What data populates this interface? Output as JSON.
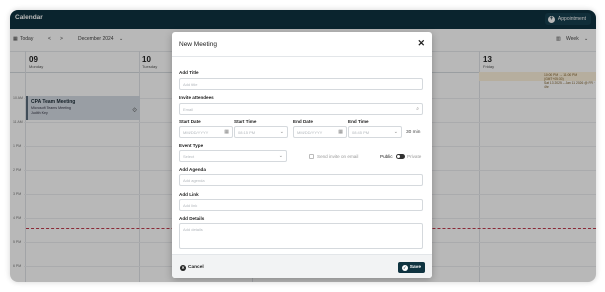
{
  "app": {
    "title": "Calendar",
    "appointment_label": "Appointment"
  },
  "toolbar": {
    "today_label": "Today",
    "prev": "<",
    "next": ">",
    "range": "December 2024",
    "range_arrow": "⌄",
    "view": "Week"
  },
  "days": [
    {
      "num": "09",
      "name": "Monday"
    },
    {
      "num": "10",
      "name": "Tuesday"
    },
    {
      "num": "13",
      "name": "Friday"
    }
  ],
  "times": [
    "10 AM",
    "11 AM",
    "1 PM",
    "2 PM",
    "3 PM",
    "4 PM",
    "5 PM",
    "6 PM",
    "7 PM"
  ],
  "allday_event": {
    "line1": "10:00 PM → 11:00 PM (GMT+05:30)",
    "line2": "Sat 13 2025 – Jan 11 2026 @ FR · 4hr"
  },
  "event": {
    "title": "CPA Team Meeting",
    "subtitle": "Microsoft Teams Meeting",
    "person": "Judith Key",
    "icon": "dots-icon"
  },
  "modal": {
    "title": "New Meeting",
    "close": "✕",
    "add_title_label": "Add Title",
    "add_title_placeholder": "Add title",
    "invite_label": "Invite attendees",
    "invite_placeholder": "Email",
    "start_date_label": "Start Date",
    "start_date_placeholder": "MM/DD/YYYY",
    "start_time_label": "Start Time",
    "start_time_placeholder": "08:15 PM",
    "end_date_label": "End Date",
    "end_date_placeholder": "MM/DD/YYYY",
    "end_time_label": "End Time",
    "end_time_placeholder": "08:45 PM",
    "duration": "30 min",
    "event_type_label": "Event Type",
    "event_type_placeholder": "Select",
    "send_invite_label": "Send invite on email",
    "public_label": "Public",
    "private_label": "Private",
    "agenda_label": "Add Agenda",
    "agenda_placeholder": "Add agenda",
    "link_label": "Add Link",
    "link_placeholder": "Add link",
    "details_label": "Add Details",
    "details_placeholder": "Add details",
    "cancel_label": "Cancel",
    "save_label": "Save"
  },
  "colors": {
    "header": "#0f3340",
    "event_bg": "#d5dce3",
    "now_line": "#c0394b",
    "allday_bg": "#fdf1dc"
  }
}
